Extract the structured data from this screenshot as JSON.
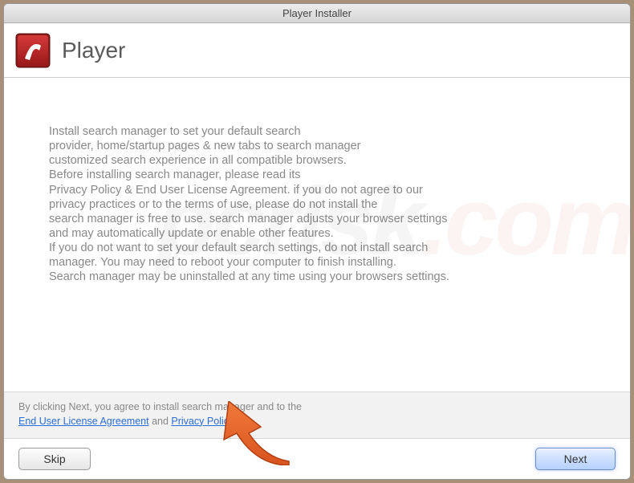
{
  "window": {
    "title": "Player Installer"
  },
  "header": {
    "title": "Player"
  },
  "content": {
    "body": "Install search manager to set your default search\nprovider, home/startup pages & new tabs to search manager\ncustomized search experience in all compatible browsers.\nBefore installing search manager, please read its\nPrivacy Policy & End User License Agreement. if you do not agree to our\nprivacy practices or to the terms of use, please do not install the\nsearch manager is free to use. search manager adjusts your browser settings\nand may automatically update or enable other features.\nIf you do not want to set your default search settings, do not install search\nmanager. You may need to reboot your computer to finish installing.\nSearch manager may be uninstalled at any time using your browsers settings."
  },
  "agreement": {
    "prefix": "By clicking Next, you agree to install search manager and to the",
    "eula": "End User License Agreement",
    "joiner": " and ",
    "privacy": "Privacy Policy",
    "suffix": "."
  },
  "footer": {
    "skip": "Skip",
    "next": "Next"
  },
  "watermark": {
    "text1": "pcrisk",
    "text2": ".com"
  }
}
